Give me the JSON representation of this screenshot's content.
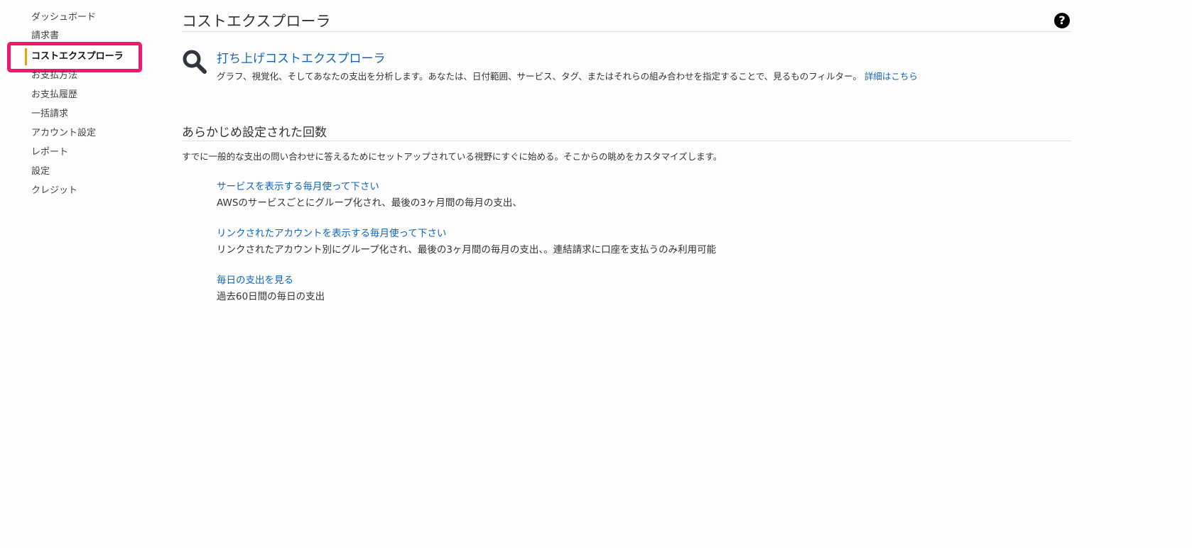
{
  "sidebar": {
    "items": [
      {
        "label": "ダッシュボード"
      },
      {
        "label": "請求書"
      },
      {
        "label": "コストエクスプローラ",
        "active": true
      },
      {
        "label": "お支払方法"
      },
      {
        "label": "お支払履歴"
      },
      {
        "label": "一括請求"
      },
      {
        "label": "アカウント設定"
      },
      {
        "label": "レポート"
      },
      {
        "label": "設定"
      },
      {
        "label": "クレジット"
      }
    ]
  },
  "main": {
    "title": "コストエクスプローラ",
    "help_icon": "question-circle-icon",
    "launch": {
      "icon": "magnifier-icon",
      "link": "打ち上げコストエクスプローラ",
      "description": "グラフ、視覚化、そしてあなたの支出を分析します。あなたは、日付範囲、サービス、タグ、またはそれらの組み合わせを指定することで、見るものフィルター。",
      "details_link": "詳細はこちら"
    },
    "preset": {
      "title": "あらかじめ設定された回数",
      "description": "すでに一般的な支出の問い合わせに答えるためにセットアップされている視野にすぐに始める。そこからの眺めをカスタマイズします。",
      "reports": [
        {
          "link": "サービスを表示する毎月使って下さい",
          "description": "AWSのサービスごとにグループ化され、最後の3ヶ月間の毎月の支出、"
        },
        {
          "link": "リンクされたアカウントを表示する毎月使って下さい",
          "description": "リンクされたアカウント別にグループ化され、最後の3ヶ月間の毎月の支出、。連結請求に口座を支払うのみ利用可能"
        },
        {
          "link": "毎日の支出を見る",
          "description": "過去60日間の毎日の支出"
        }
      ]
    }
  },
  "colors": {
    "accent": "#f90",
    "highlight": "#f0196b",
    "link": "#1166bb"
  }
}
